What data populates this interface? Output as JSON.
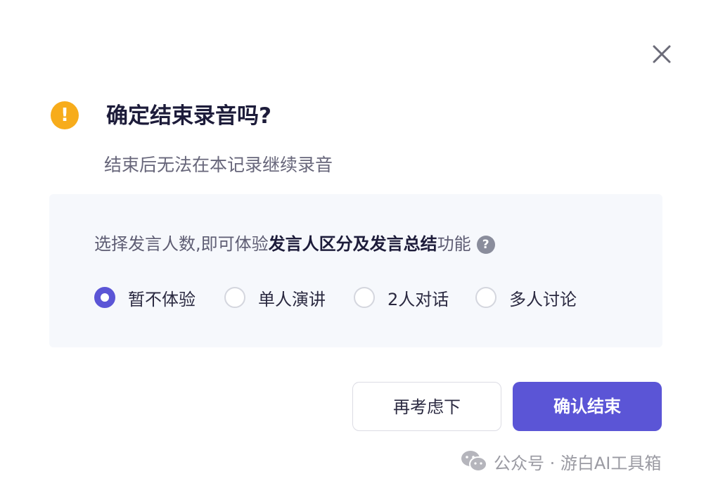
{
  "dialog": {
    "title": "确定结束录音吗?",
    "subtitle": "结束后无法在本记录继续录音",
    "warning_icon": "exclamation-circle-icon",
    "warning_glyph": "!",
    "close_icon": "close-icon"
  },
  "speaker_panel": {
    "prompt_prefix": "选择发言人数,即可体验",
    "prompt_highlight": "发言人区分及发言总结",
    "prompt_suffix": "功能",
    "help_glyph": "?",
    "help_icon": "question-circle-icon",
    "options": [
      {
        "label": "暂不体验",
        "selected": true
      },
      {
        "label": "单人演讲",
        "selected": false
      },
      {
        "label": "2人对话",
        "selected": false
      },
      {
        "label": "多人讨论",
        "selected": false
      }
    ]
  },
  "buttons": {
    "cancel_label": "再考虑下",
    "confirm_label": "确认结束"
  },
  "watermark": {
    "icon": "wechat-icon",
    "text": "公众号 · 游白AI工具箱"
  },
  "colors": {
    "accent": "#5b55d6",
    "warning": "#f7ac1b",
    "panel_bg": "#f6f8fc",
    "title": "#1d1c3a"
  }
}
